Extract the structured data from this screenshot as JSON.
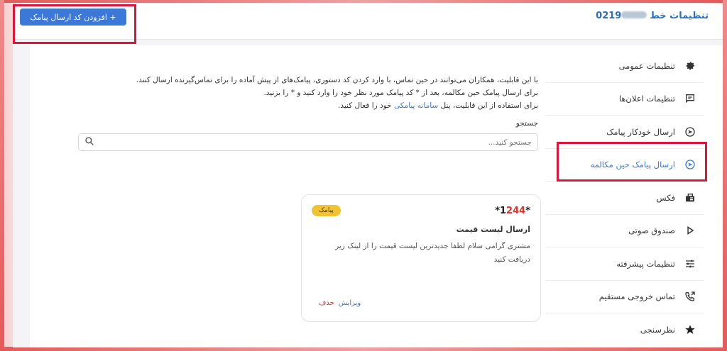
{
  "header": {
    "title": "تنظیمات خط",
    "phone_prefix": "0219",
    "add_button_label": "+ افزودن کد ارسال پیامک"
  },
  "sidebar": {
    "items": [
      {
        "label": "تنظیمات عمومی",
        "icon": "gear-icon"
      },
      {
        "label": "تنظیمات اعلان‌ها",
        "icon": "message-icon"
      },
      {
        "label": "ارسال خودکار پیامک",
        "icon": "send-circle-icon"
      },
      {
        "label": "ارسال پیامک حین مکالمه",
        "icon": "send-circle-icon",
        "active": true
      },
      {
        "label": "فکس",
        "icon": "fax-icon"
      },
      {
        "label": "صندوق صوتی",
        "icon": "play-icon"
      },
      {
        "label": "تنظیمات پیشرفته",
        "icon": "sliders-icon"
      },
      {
        "label": "تماس خروجی مستقیم",
        "icon": "phone-forward-icon"
      },
      {
        "label": "نظرسنجی",
        "icon": "star-icon"
      }
    ]
  },
  "main": {
    "description_line1": "با این قابلیت، همکاران می‌توانند در حین تماس، با وارد کردن کد دستوری، پیامک‌های از پیش آماده را برای تماس‌گیرنده ارسال کنند.",
    "description_line2": "برای ارسال پیامک حین مکالمه، بعد از * کد پیامک مورد نظر خود را وارد کنید و * را بزنید.",
    "description_line3_before": "برای استفاده از این قابلیت، پنل ",
    "description_line3_link": "سامانه پیامکی",
    "description_line3_after": " خود را فعال کنید.",
    "search_label": "جستجو",
    "search_placeholder": "جستجو کنید..."
  },
  "card": {
    "code_prefix": "*1",
    "code_highlight": "244",
    "code_suffix": "*",
    "badge": "پیامک",
    "title": "ارسال لیست قیمت",
    "body": "مشتری گرامی سلام لطفا جدیدترین لیست قیمت را از لینک زیر دریافت کنید",
    "edit_label": "ویرایش",
    "delete_label": "حذف"
  },
  "colors": {
    "accent": "#3c78d8",
    "highlight_border": "#d9173a",
    "badge": "#f1c232",
    "delete": "#e0322d"
  }
}
